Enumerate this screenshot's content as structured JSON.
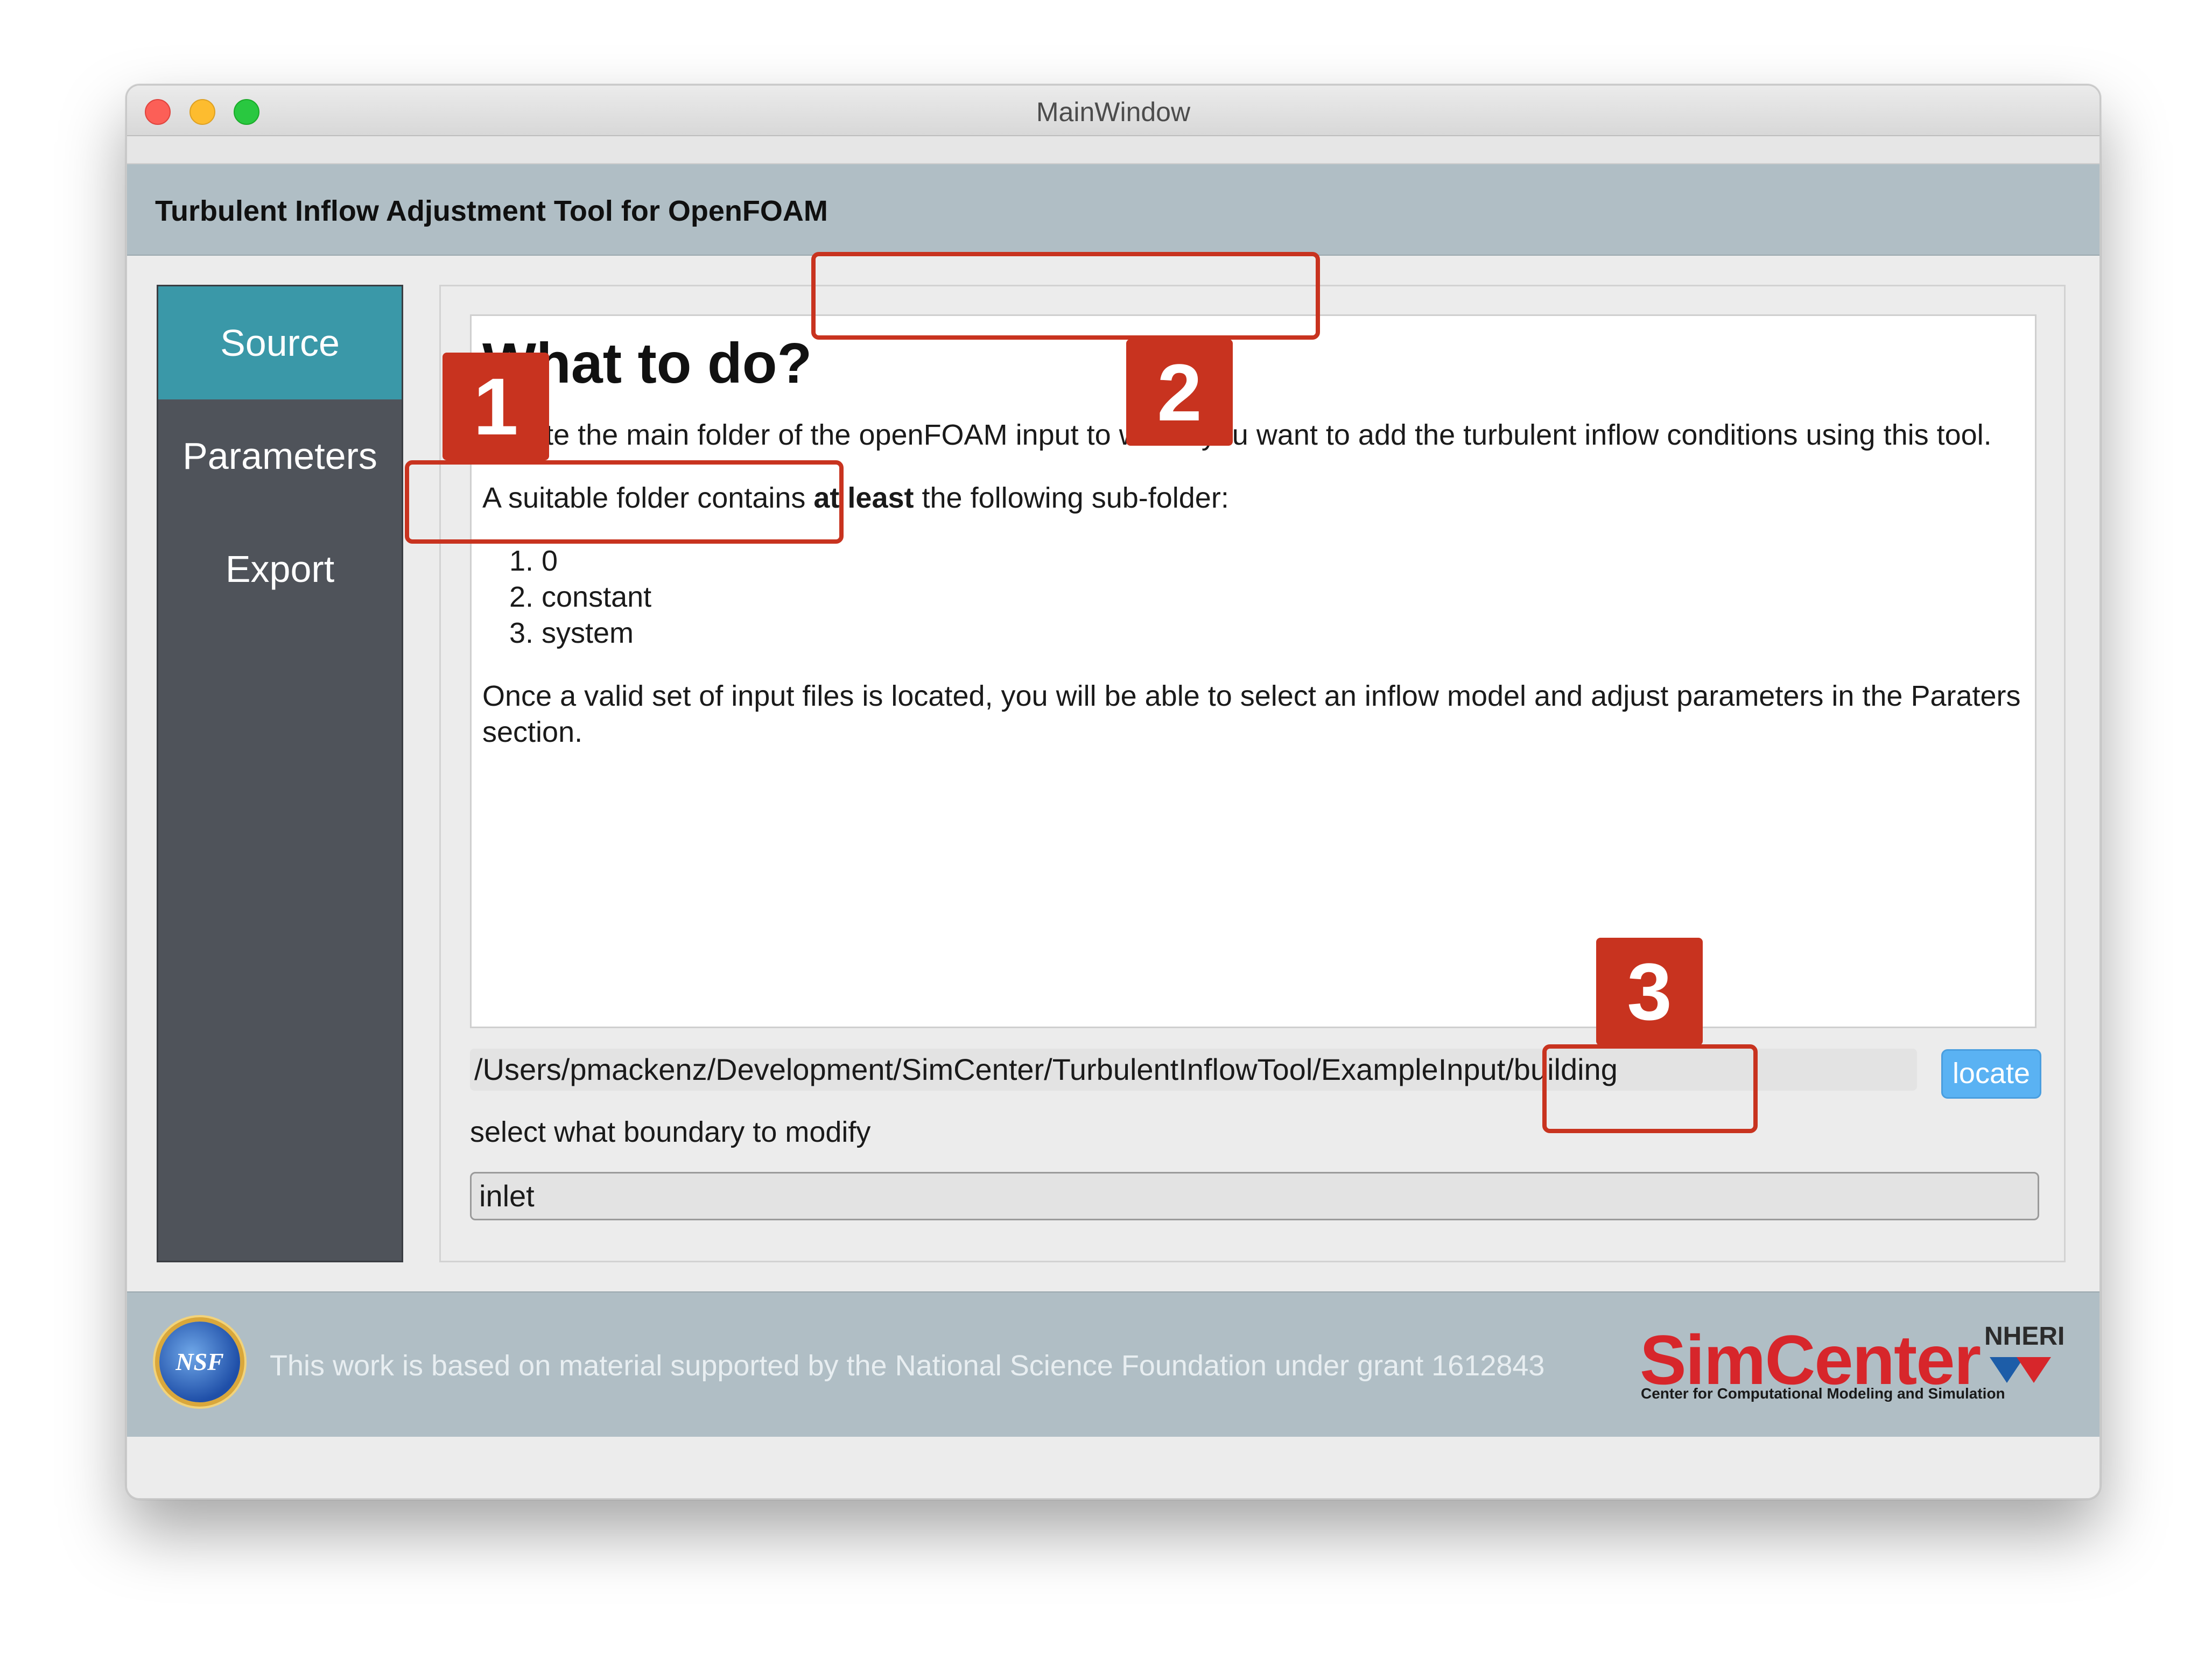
{
  "window": {
    "title": "MainWindow"
  },
  "header": {
    "app_title": "Turbulent Inflow Adjustment Tool for OpenFOAM"
  },
  "sidebar": {
    "items": [
      {
        "label": "Source",
        "active": true
      },
      {
        "label": "Parameters",
        "active": false
      },
      {
        "label": "Export",
        "active": false
      }
    ]
  },
  "instructions": {
    "heading": "What to do?",
    "para1": "Locate the main folder of the openFOAM input to which you want to add the turbulent inflow conditions using this tool.",
    "para2_pre": "A suitable folder contains ",
    "para2_bold": "at least",
    "para2_post": " the following sub-folder:",
    "folders": [
      "0",
      "constant",
      "system"
    ],
    "para3": "Once a valid set of input files is located, you will be able to select an inflow model and adjust parameters in the Paraters section."
  },
  "source": {
    "path": "/Users/pmackenz/Development/SimCenter/TurbulentInflowTool/ExampleInput/building",
    "locate_label": "locate",
    "boundary_label": "select what boundary to modify",
    "boundary_value": "inlet"
  },
  "footer": {
    "nsf_logo_text": "NSF",
    "note": "This work is based on material supported by the National Science Foundation under grant 1612843",
    "simcenter_word": "SimCenter",
    "nheri": "NHERI",
    "simcenter_sub": "Center for Computational Modeling and Simulation"
  },
  "callouts": [
    "1",
    "2",
    "3"
  ],
  "colors": {
    "header_bg": "#b0bec5",
    "sidebar_bg": "#4f535a",
    "sidebar_active": "#3a98a8",
    "locate_button": "#5ab2f3",
    "callout": "#c8331f"
  }
}
